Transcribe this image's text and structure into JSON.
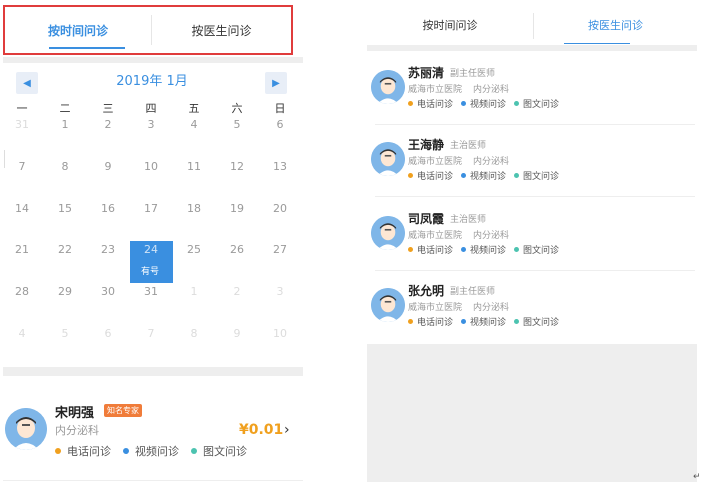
{
  "left": {
    "tabs": [
      {
        "label": "按时间问诊"
      },
      {
        "label": "按医生问诊"
      }
    ],
    "calendar": {
      "title": "2019年 1月",
      "prev_icon": "chevron-left-icon",
      "next_icon": "chevron-right-icon",
      "weekdays": [
        "一",
        "二",
        "三",
        "四",
        "五",
        "六",
        "日"
      ],
      "rows": [
        [
          "31",
          "1",
          "2",
          "3",
          "4",
          "5",
          "6"
        ],
        [
          "7",
          "8",
          "9",
          "10",
          "11",
          "12",
          "13"
        ],
        [
          "14",
          "15",
          "16",
          "17",
          "18",
          "19",
          "20"
        ],
        [
          "21",
          "22",
          "23",
          "24",
          "25",
          "26",
          "27"
        ],
        [
          "28",
          "29",
          "30",
          "31",
          "1",
          "2",
          "3"
        ],
        [
          "4",
          "5",
          "6",
          "7",
          "8",
          "9",
          "10"
        ]
      ],
      "has_slot_label": "有号"
    },
    "doctor": {
      "name": "宋明强",
      "badge": "知名专家",
      "dept": "内分泌科",
      "price": "¥0.01",
      "services": [
        "电话问诊",
        "视频问诊",
        "图文问诊"
      ],
      "arrow_icon": "chevron-right-icon"
    }
  },
  "right": {
    "tabs": [
      {
        "label": "按时间问诊"
      },
      {
        "label": "按医生问诊"
      }
    ],
    "doctors": [
      {
        "name": "苏丽清",
        "title": "副主任医师",
        "hospital": "威海市立医院",
        "dept": "内分泌科",
        "services": [
          "电话问诊",
          "视频问诊",
          "图文问诊"
        ]
      },
      {
        "name": "王海静",
        "title": "主治医师",
        "hospital": "威海市立医院",
        "dept": "内分泌科",
        "services": [
          "电话问诊",
          "视频问诊",
          "图文问诊"
        ]
      },
      {
        "name": "司凤霞",
        "title": "主治医师",
        "hospital": "威海市立医院",
        "dept": "内分泌科",
        "services": [
          "电话问诊",
          "视频问诊",
          "图文问诊"
        ]
      },
      {
        "name": "张允明",
        "title": "副主任医师",
        "hospital": "威海市立医院",
        "dept": "内分泌科",
        "services": [
          "电话问诊",
          "视频问诊",
          "图文问诊"
        ]
      }
    ]
  },
  "colors": {
    "accent": "#3a8fe0",
    "phone": "#f0a01e",
    "video": "#3a8fe0",
    "text": "#4cc3b0",
    "highlight_box": "#e03c3c"
  },
  "misc": {
    "return_mark": "↵"
  }
}
